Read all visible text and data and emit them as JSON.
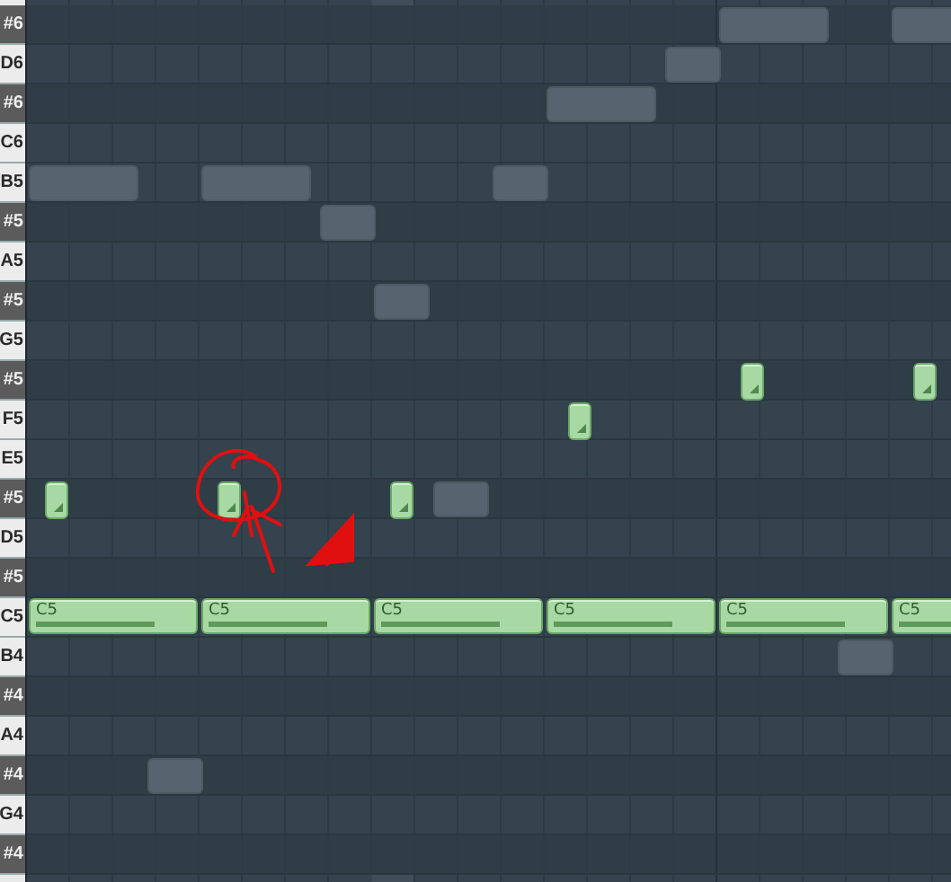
{
  "keys": [
    {
      "label": "#6",
      "kind": "black"
    },
    {
      "label": "D6",
      "kind": "white"
    },
    {
      "label": "#6",
      "kind": "black"
    },
    {
      "label": "C6",
      "kind": "white"
    },
    {
      "label": "B5",
      "kind": "white"
    },
    {
      "label": "#5",
      "kind": "black"
    },
    {
      "label": "A5",
      "kind": "white"
    },
    {
      "label": "#5",
      "kind": "black"
    },
    {
      "label": "G5",
      "kind": "white"
    },
    {
      "label": "#5",
      "kind": "black"
    },
    {
      "label": "F5",
      "kind": "white"
    },
    {
      "label": "E5",
      "kind": "white"
    },
    {
      "label": "#5",
      "kind": "black"
    },
    {
      "label": "D5",
      "kind": "white"
    },
    {
      "label": "#5",
      "kind": "black"
    },
    {
      "label": "C5",
      "kind": "white"
    },
    {
      "label": "B4",
      "kind": "white"
    },
    {
      "label": "#4",
      "kind": "black"
    },
    {
      "label": "A4",
      "kind": "white"
    },
    {
      "label": "#4",
      "kind": "black"
    },
    {
      "label": "G4",
      "kind": "white"
    },
    {
      "label": "#4",
      "kind": "black"
    }
  ],
  "notes": [
    {
      "kind": "ghost"
    },
    {
      "kind": "ghost"
    },
    {
      "kind": "ghost"
    },
    {
      "kind": "ghost"
    },
    {
      "kind": "ghost"
    },
    {
      "kind": "ghost"
    },
    {
      "kind": "ghost"
    },
    {
      "kind": "ghost"
    },
    {
      "kind": "ghost"
    },
    {
      "kind": "short"
    },
    {
      "kind": "short"
    },
    {
      "kind": "short"
    },
    {
      "kind": "short"
    },
    {
      "kind": "short"
    },
    {
      "kind": "short"
    },
    {
      "kind": "ghost"
    },
    {
      "kind": "long",
      "label": "C5",
      "level": 0.77
    },
    {
      "kind": "long",
      "label": "C5",
      "level": 0.77
    },
    {
      "kind": "long",
      "label": "C5",
      "level": 0.77
    },
    {
      "kind": "long",
      "label": "C5",
      "level": 0.77
    },
    {
      "kind": "long",
      "label": "C5",
      "level": 0.77
    },
    {
      "kind": "long",
      "label": "C5"
    },
    {
      "kind": "ghost"
    },
    {
      "kind": "ghost"
    }
  ]
}
